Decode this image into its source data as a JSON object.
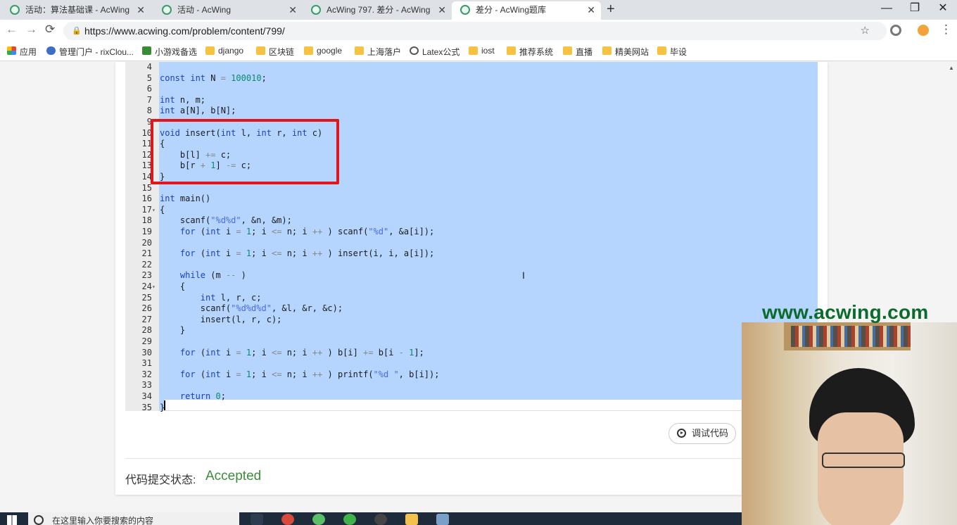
{
  "browser": {
    "tabs": [
      {
        "title": "活动：算法基础课 - AcWing",
        "active": false
      },
      {
        "title": "活动 - AcWing",
        "active": false
      },
      {
        "title": "AcWing 797. 差分 - AcWing",
        "active": false
      },
      {
        "title": "差分 - AcWing题库",
        "active": true
      }
    ],
    "new_tab": "+",
    "url": "https://www.acwing.com/problem/content/799/",
    "window_controls": {
      "minimize": "—",
      "maximize": "❐",
      "close": "✕"
    }
  },
  "bookmarks": [
    {
      "label": "应用",
      "icon": "apps-icon"
    },
    {
      "label": "管理门户 - rixClou...",
      "icon": "cloud-icon"
    },
    {
      "label": "小游戏备选",
      "icon": "game-icon"
    },
    {
      "label": "django",
      "icon": "folder-icon"
    },
    {
      "label": "区块链",
      "icon": "folder-icon"
    },
    {
      "label": "google",
      "icon": "folder-icon"
    },
    {
      "label": "上海落户",
      "icon": "folder-icon"
    },
    {
      "label": "Latex公式",
      "icon": "globe-icon"
    },
    {
      "label": "iost",
      "icon": "folder-icon"
    },
    {
      "label": "推荐系统",
      "icon": "folder-icon"
    },
    {
      "label": "直播",
      "icon": "folder-icon"
    },
    {
      "label": "精美网站",
      "icon": "folder-icon"
    },
    {
      "label": "毕设",
      "icon": "folder-icon"
    }
  ],
  "editor": {
    "lines": [
      {
        "n": "4",
        "code": "",
        "fold": false
      },
      {
        "n": "5",
        "code": "const int N = 100010;",
        "fold": false
      },
      {
        "n": "6",
        "code": "",
        "fold": false
      },
      {
        "n": "7",
        "code": "int n, m;",
        "fold": false
      },
      {
        "n": "8",
        "code": "int a[N], b[N];",
        "fold": false
      },
      {
        "n": "9",
        "code": "",
        "fold": false
      },
      {
        "n": "10",
        "code": "void insert(int l, int r, int c)",
        "fold": false
      },
      {
        "n": "11",
        "code": "{",
        "fold": false
      },
      {
        "n": "12",
        "code": "    b[l] += c;",
        "fold": false
      },
      {
        "n": "13",
        "code": "    b[r + 1] -= c;",
        "fold": false
      },
      {
        "n": "14",
        "code": "}",
        "fold": false
      },
      {
        "n": "15",
        "code": "",
        "fold": false
      },
      {
        "n": "16",
        "code": "int main()",
        "fold": false
      },
      {
        "n": "17",
        "code": "{",
        "fold": true
      },
      {
        "n": "18",
        "code": "    scanf(\"%d%d\", &n, &m);",
        "fold": false
      },
      {
        "n": "19",
        "code": "    for (int i = 1; i <= n; i ++ ) scanf(\"%d\", &a[i]);",
        "fold": false
      },
      {
        "n": "20",
        "code": "",
        "fold": false
      },
      {
        "n": "21",
        "code": "    for (int i = 1; i <= n; i ++ ) insert(i, i, a[i]);",
        "fold": false
      },
      {
        "n": "22",
        "code": "",
        "fold": false
      },
      {
        "n": "23",
        "code": "    while (m -- )",
        "fold": false
      },
      {
        "n": "24",
        "code": "    {",
        "fold": true
      },
      {
        "n": "25",
        "code": "        int l, r, c;",
        "fold": false
      },
      {
        "n": "26",
        "code": "        scanf(\"%d%d%d\", &l, &r, &c);",
        "fold": false
      },
      {
        "n": "27",
        "code": "        insert(l, r, c);",
        "fold": false
      },
      {
        "n": "28",
        "code": "    }",
        "fold": false
      },
      {
        "n": "29",
        "code": "",
        "fold": false
      },
      {
        "n": "30",
        "code": "    for (int i = 1; i <= n; i ++ ) b[i] += b[i - 1];",
        "fold": false
      },
      {
        "n": "31",
        "code": "",
        "fold": false
      },
      {
        "n": "32",
        "code": "    for (int i = 1; i <= n; i ++ ) printf(\"%d \", b[i]);",
        "fold": false
      },
      {
        "n": "33",
        "code": "",
        "fold": false
      },
      {
        "n": "34",
        "code": "    return 0;",
        "fold": false
      },
      {
        "n": "35",
        "code": "}",
        "fold": false
      }
    ],
    "highlight_color": "#e1161b"
  },
  "debug_button": {
    "label": "调试代码"
  },
  "submission": {
    "label": "代码提交状态:",
    "status": "Accepted"
  },
  "watermark": "www.acwing.com",
  "taskbar": {
    "search_placeholder": "在这里输入你要搜索的内容"
  }
}
